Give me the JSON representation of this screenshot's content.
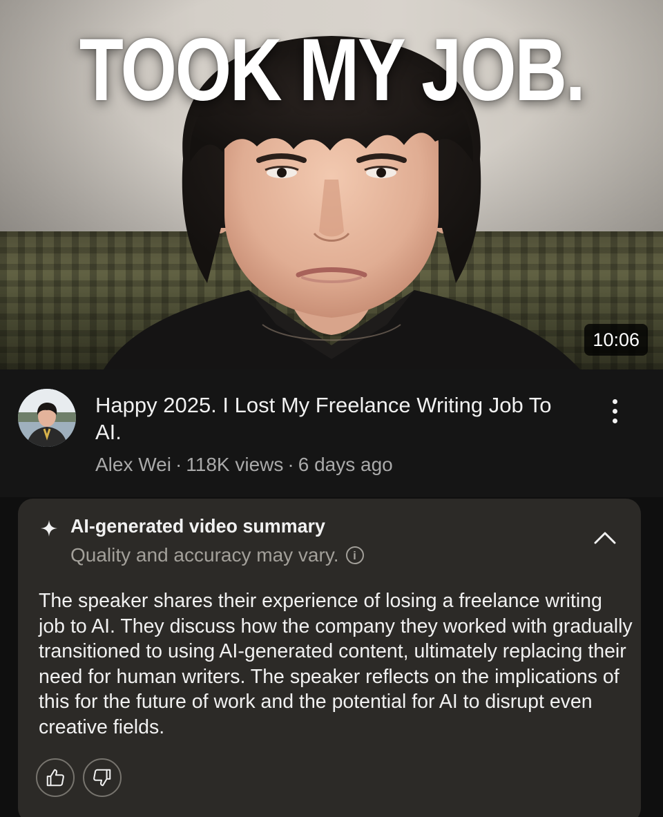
{
  "thumbnail": {
    "overlay_text": "TOOK MY JOB.",
    "duration": "10:06"
  },
  "video": {
    "title": "Happy 2025. I Lost My Freelance Writing Job To AI.",
    "channel": "Alex Wei",
    "views": "118K views",
    "age": "6 days ago",
    "separator": "·"
  },
  "summary_card": {
    "icon": "sparkle-icon",
    "heading": "AI-generated video summary",
    "subheading": "Quality and accuracy may vary.",
    "info_icon_glyph": "i",
    "collapse_icon": "chevron-up-icon",
    "body": "The speaker shares their experience of losing a freelance writing job to AI. They discuss how the company they worked with gradually transitioned to using AI-generated content, ultimately replacing their need for human writers. The speaker reflects on the implications of this for the future of work and the potential for AI to disrupt even creative fields.",
    "feedback": {
      "like_icon": "thumbs-up-icon",
      "dislike_icon": "thumbs-down-icon"
    }
  },
  "colors": {
    "background": "#0f0f0f",
    "info_background": "#151515",
    "card_background": "#2c2a27",
    "primary_text": "#f1f1f1",
    "secondary_text": "#aaaaaa"
  }
}
